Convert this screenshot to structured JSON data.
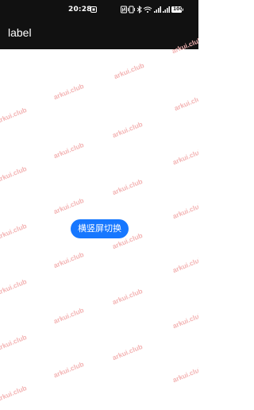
{
  "status_bar": {
    "time": "20:28",
    "battery": "100",
    "colors": {
      "background": "#111111",
      "foreground": "#ffffff"
    },
    "icons": [
      "app-notification-icon",
      "nfc-icon",
      "vibrate-icon",
      "bluetooth-icon",
      "wifi-icon",
      "signal-icon",
      "battery-icon"
    ]
  },
  "app_bar": {
    "title": "label",
    "colors": {
      "background": "#111111",
      "foreground": "#ffffff"
    }
  },
  "watermark": {
    "text": "arkui.club",
    "color": "#f3b3b3"
  },
  "main": {
    "toggle_button_label": "横竖屏切换",
    "colors": {
      "button_background": "#1677ff",
      "button_text": "#ffffff"
    }
  }
}
